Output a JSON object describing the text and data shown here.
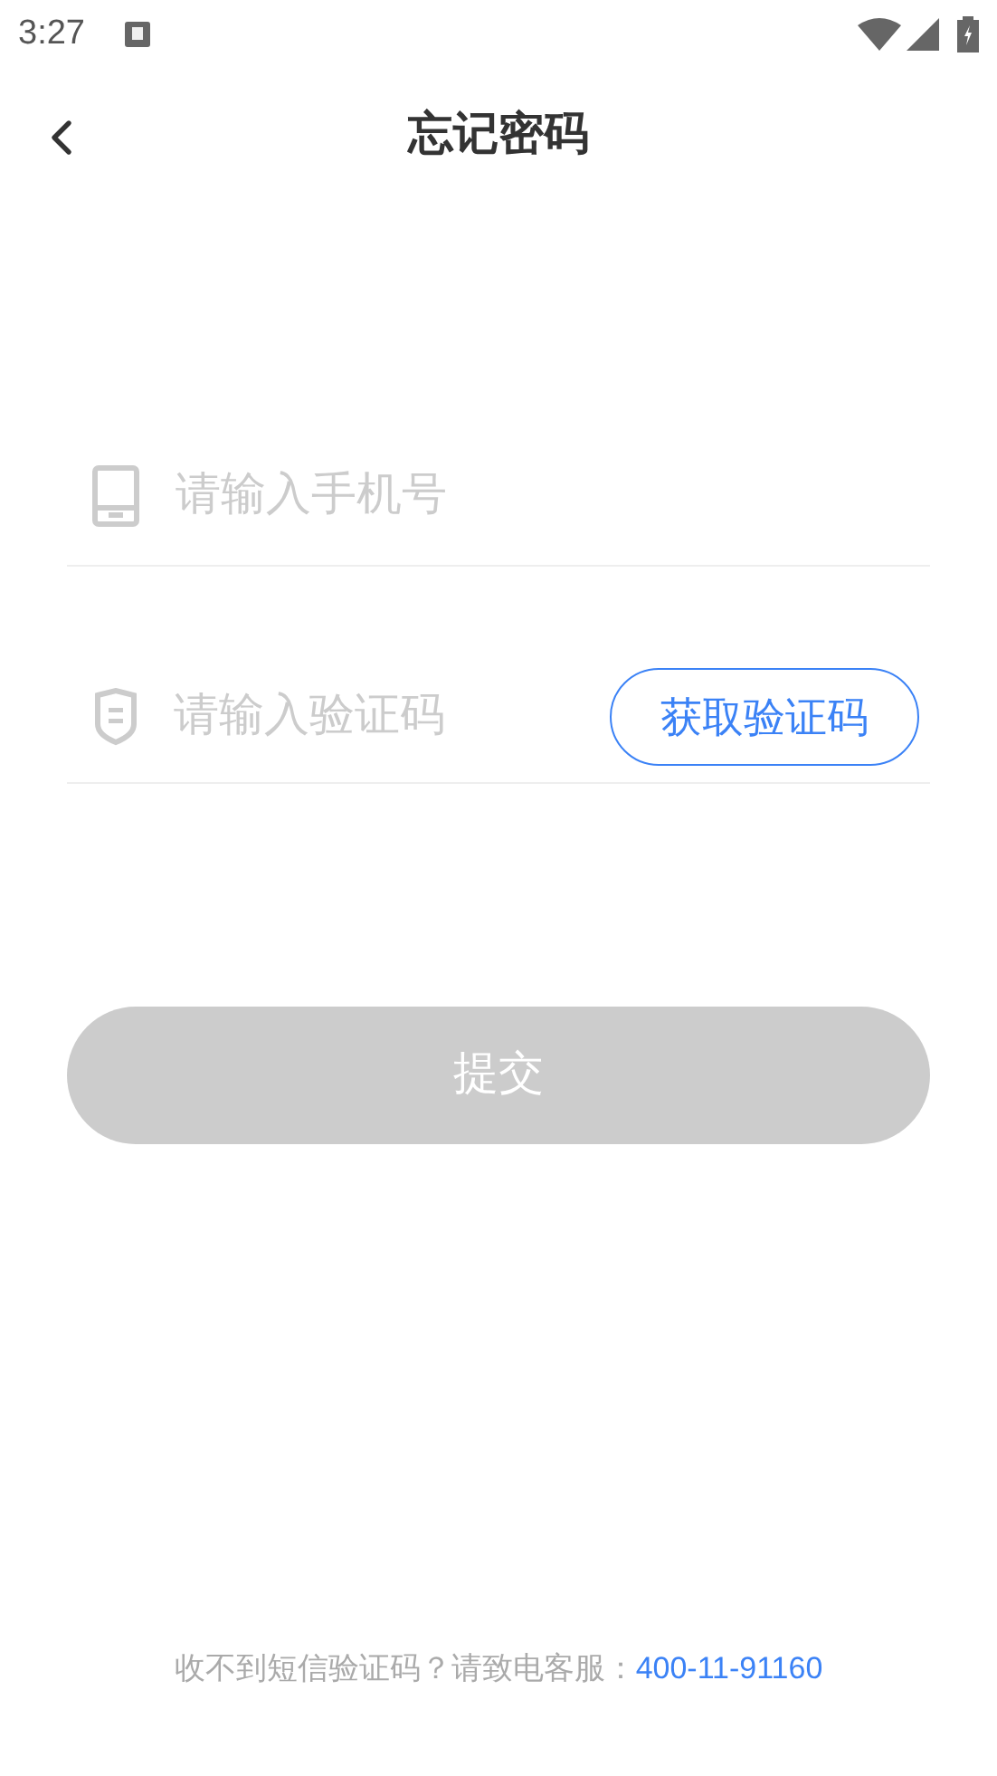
{
  "status_bar": {
    "time": "3:27"
  },
  "header": {
    "title": "忘记密码"
  },
  "phone_field": {
    "placeholder": "请输入手机号"
  },
  "code_field": {
    "placeholder": "请输入验证码"
  },
  "get_code_button": {
    "label": "获取验证码"
  },
  "submit_button": {
    "label": "提交",
    "disabled": true
  },
  "footer": {
    "text": "收不到短信验证码？请致电客服：",
    "phone": "400-11-91160"
  }
}
